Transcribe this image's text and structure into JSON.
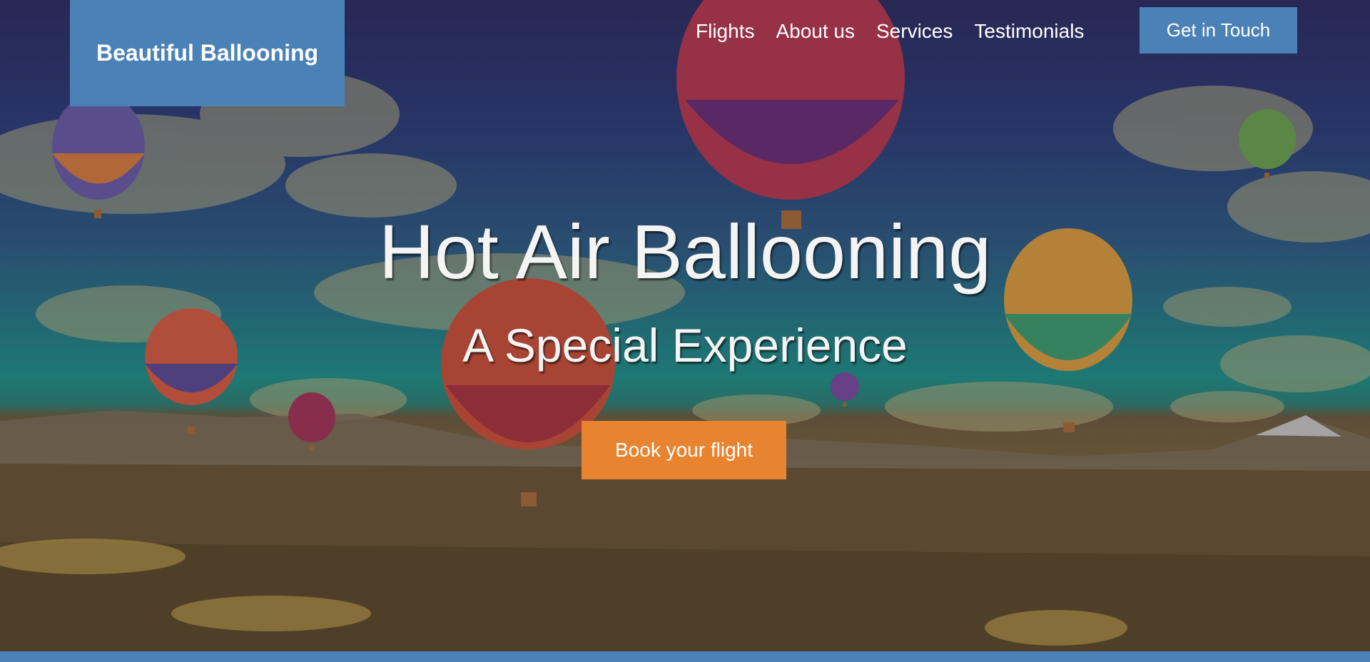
{
  "brand": {
    "name": "Beautiful Ballooning",
    "color": "#4a82b8"
  },
  "nav": {
    "items": [
      {
        "label": "Flights"
      },
      {
        "label": "About us"
      },
      {
        "label": "Services"
      },
      {
        "label": "Testimonials"
      }
    ],
    "cta_label": "Get in Touch"
  },
  "hero": {
    "title": "Hot Air Ballooning",
    "subtitle": "A Special Experience",
    "button_label": "Book your flight",
    "button_color": "#e8842f",
    "background_image": "hot-air-balloons-over-valley"
  }
}
